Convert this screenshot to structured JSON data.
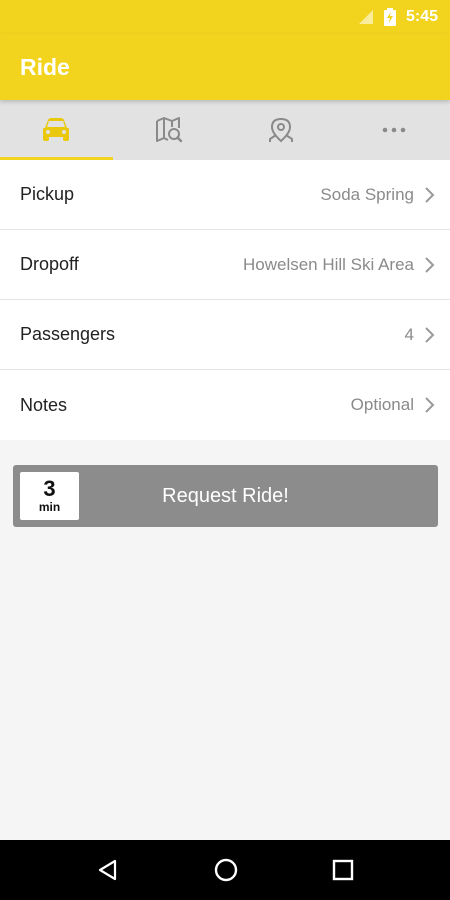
{
  "status_bar": {
    "time": "5:45"
  },
  "app_bar": {
    "title": "Ride",
    "color": "#f2d41f"
  },
  "tabs": [
    {
      "icon": "car-icon",
      "active": true
    },
    {
      "icon": "map-search-icon",
      "active": false
    },
    {
      "icon": "location-pin-icon",
      "active": false
    },
    {
      "icon": "more-icon",
      "active": false
    }
  ],
  "form": {
    "pickup": {
      "label": "Pickup",
      "value": "Soda Spring"
    },
    "dropoff": {
      "label": "Dropoff",
      "value": "Howelsen Hill Ski Area"
    },
    "passengers": {
      "label": "Passengers",
      "value": "4"
    },
    "notes": {
      "label": "Notes",
      "value": "Optional"
    }
  },
  "request": {
    "eta_value": "3",
    "eta_unit": "min",
    "label": "Request Ride!"
  },
  "nav_bar": {
    "icons": [
      "back-icon",
      "home-icon",
      "recents-icon"
    ]
  }
}
